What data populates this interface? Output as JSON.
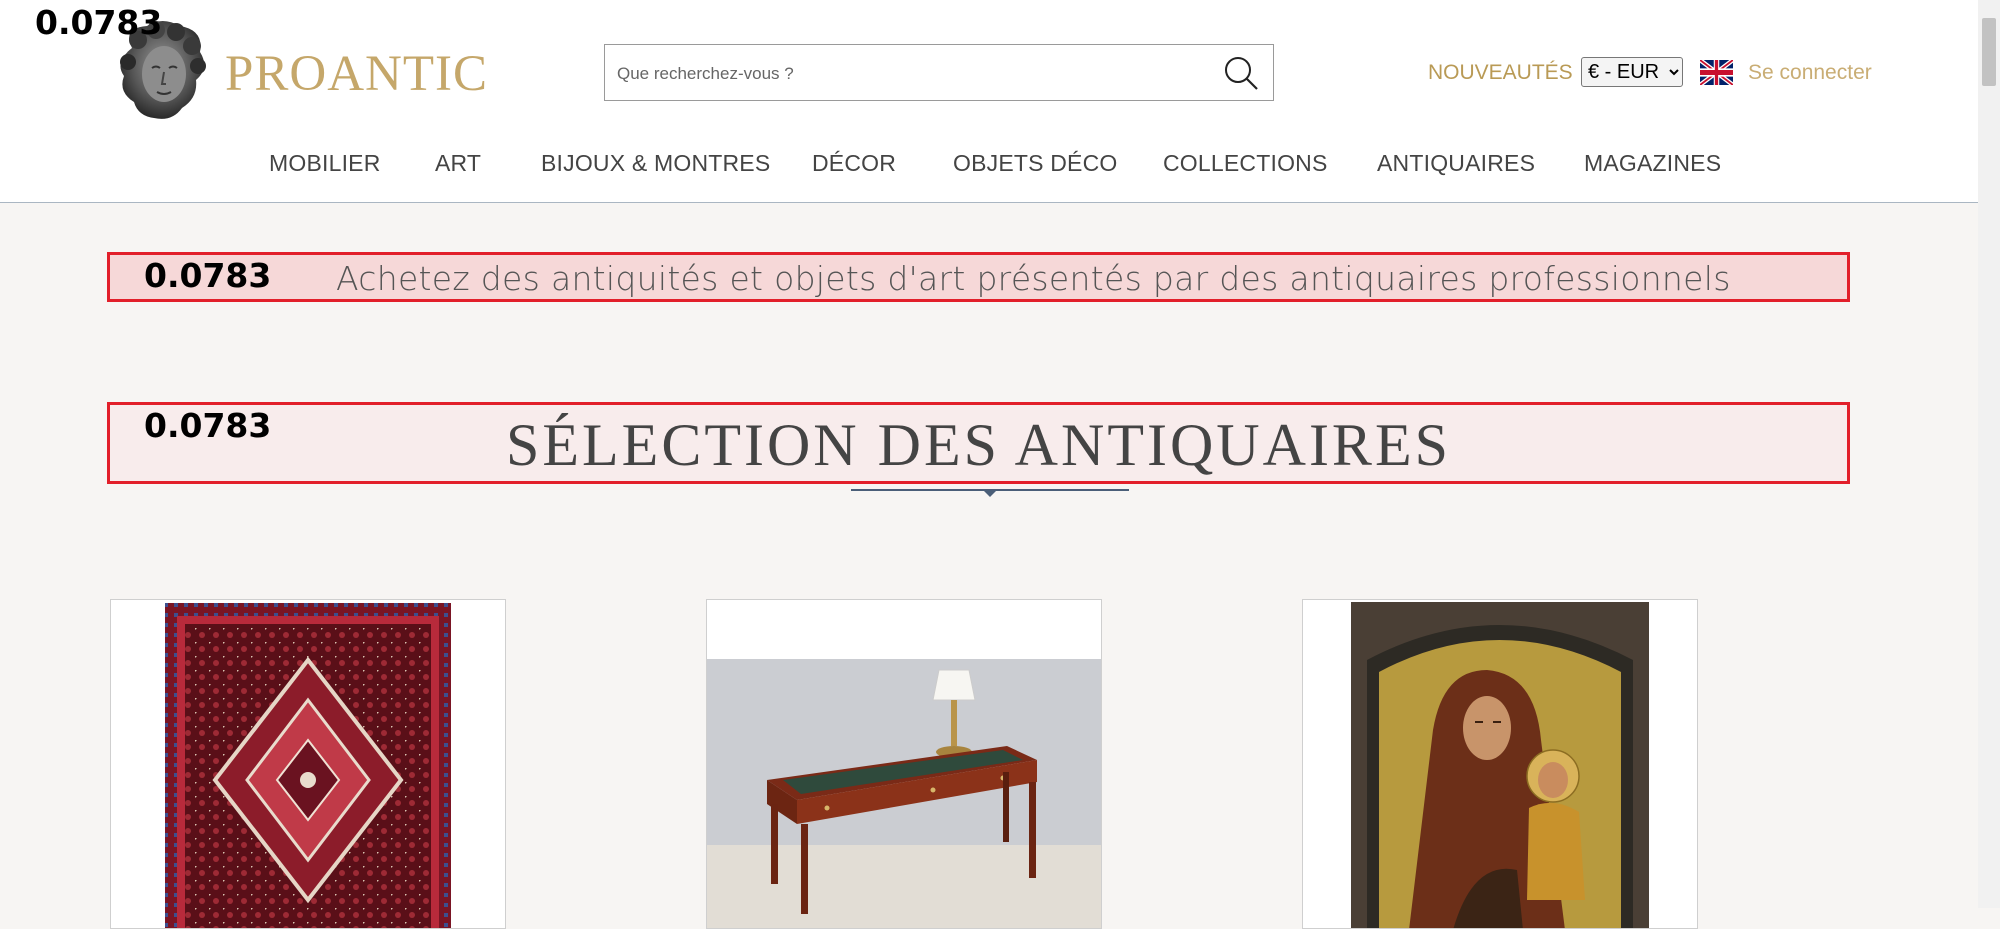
{
  "debug": {
    "score": "0.0783"
  },
  "header": {
    "brand": "PROANTIC",
    "search": {
      "placeholder": "Que recherchez-vous ?",
      "value": ""
    },
    "nouveautes": "NOUVEAUTÉS",
    "currency": {
      "selected": "€ - EUR"
    },
    "login": "Se connecter",
    "icons": {
      "search": "search-icon",
      "flag": "uk-flag-icon",
      "logo": "statue-head-logo"
    }
  },
  "nav": {
    "items": [
      {
        "label": "MOBILIER"
      },
      {
        "label": "ART"
      },
      {
        "label": "BIJOUX & MONTRES"
      },
      {
        "label": "DÉCOR"
      },
      {
        "label": "OBJETS DÉCO"
      },
      {
        "label": "COLLECTIONS"
      },
      {
        "label": "ANTIQUAIRES"
      },
      {
        "label": "MAGAZINES"
      }
    ]
  },
  "main": {
    "tagline": "Achetez des antiquités et objets d'art présentés par des antiquaires professionnels",
    "section_title": "SÉLECTION DES ANTIQUAIRES",
    "cards": [
      {
        "image": "persian-rug"
      },
      {
        "image": "antique-desk-with-lamp"
      },
      {
        "image": "madonna-and-child-icon-painting"
      }
    ]
  },
  "colors": {
    "brand_gold": "#c5a76a",
    "highlight_border": "#e21f2a",
    "nav_text": "#444444"
  }
}
